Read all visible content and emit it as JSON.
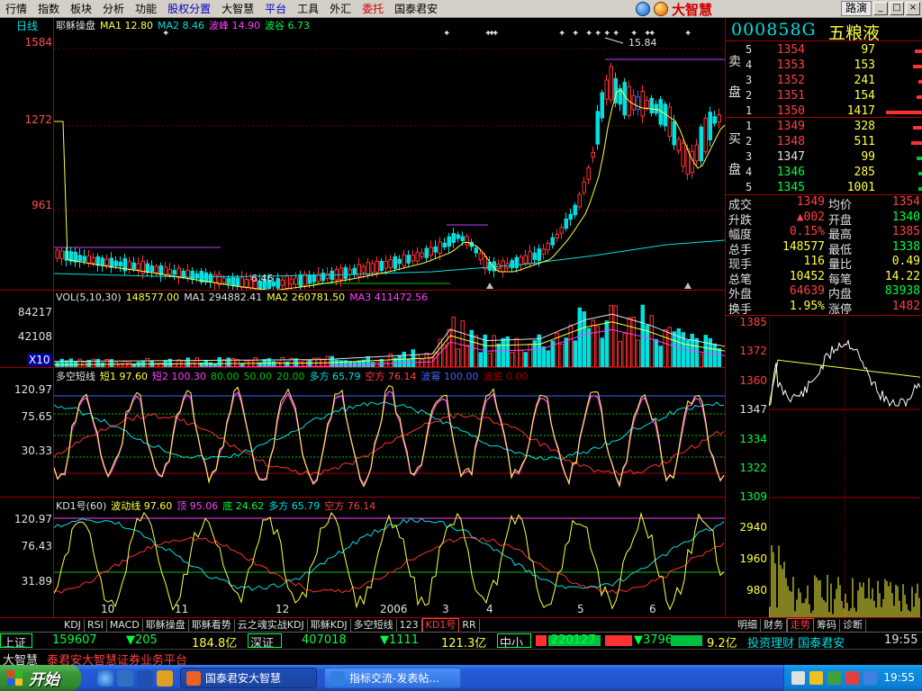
{
  "menu": {
    "items": [
      {
        "label": "行情",
        "color": "normal"
      },
      {
        "label": "指数",
        "color": "normal"
      },
      {
        "label": "板块",
        "color": "normal"
      },
      {
        "label": "分析",
        "color": "normal"
      },
      {
        "label": "功能",
        "color": "normal"
      },
      {
        "label": "股权分置",
        "color": "blue"
      },
      {
        "label": "大智慧",
        "color": "normal"
      },
      {
        "label": "平台",
        "color": "blue"
      },
      {
        "label": "工具",
        "color": "normal"
      },
      {
        "label": "外汇",
        "color": "normal"
      },
      {
        "label": "委托",
        "color": "red"
      },
      {
        "label": "国泰君安",
        "color": "normal"
      }
    ],
    "brand": "大智慧",
    "lumi_button": "路演",
    "win_min": "_",
    "win_max": "□",
    "win_close": "×"
  },
  "main_chart": {
    "period": "日线",
    "header": [
      {
        "text": "耶稣操盘",
        "color": "#e0e0e0"
      },
      {
        "text": "MA1 12.80",
        "color": "#ffff40"
      },
      {
        "text": "MA2 8.46",
        "color": "#00e0e0"
      },
      {
        "text": "波峰 14.90",
        "color": "#ff40ff"
      },
      {
        "text": "波谷 6.73",
        "color": "#00ff40"
      }
    ],
    "y_labels": [
      "1584",
      "1272",
      "961"
    ],
    "annot_high": "15.84",
    "annot_low": "6.46"
  },
  "volume": {
    "header": [
      {
        "text": "VOL(5,10,30)",
        "color": "#e0e0e0"
      },
      {
        "text": "148577.00",
        "color": "#ffff40"
      },
      {
        "text": "MA1 294882.41",
        "color": "#e0e0e0"
      },
      {
        "text": "MA2 260781.50",
        "color": "#ffff40"
      },
      {
        "text": "MA3 411472.56",
        "color": "#ff40ff"
      }
    ],
    "y_labels": [
      "84217",
      "42108"
    ],
    "unit": "X10"
  },
  "ind1": {
    "header": [
      {
        "text": "多空短线",
        "color": "#e0e0e0"
      },
      {
        "text": "短1 97.60",
        "color": "#ffff40"
      },
      {
        "text": "短2 100.30",
        "color": "#ff40ff"
      },
      {
        "text": "80.00",
        "color": "#00c000"
      },
      {
        "text": "50.00",
        "color": "#00c000"
      },
      {
        "text": "20.00",
        "color": "#00c000"
      },
      {
        "text": "多方 65.79",
        "color": "#00e0e0"
      },
      {
        "text": "空方 76.14",
        "color": "#ff4040"
      },
      {
        "text": "波幂 100.00",
        "color": "#4060ff"
      },
      {
        "text": "波底 0.00",
        "color": "#a00000"
      }
    ],
    "y_labels": [
      "120.97",
      "75.65",
      "30.33"
    ]
  },
  "ind2": {
    "header": [
      {
        "text": "KD1号(60)",
        "color": "#e0e0e0"
      },
      {
        "text": "波动线 97.60",
        "color": "#ffff40"
      },
      {
        "text": "顶 95.06",
        "color": "#ff40ff"
      },
      {
        "text": "底 24.62",
        "color": "#00ff40"
      },
      {
        "text": "多方 65.79",
        "color": "#00e0e0"
      },
      {
        "text": "空方 76.14",
        "color": "#ff4040"
      }
    ],
    "y_labels": [
      "120.97",
      "76.43",
      "31.89"
    ],
    "x_labels": [
      "10",
      "11",
      "12",
      "2006",
      "3",
      "4",
      "5",
      "6"
    ]
  },
  "bottom_tabs": [
    "KDJ",
    "RSI",
    "MACD",
    "耶稣操盘",
    "耶稣看势",
    "云之魂实战KDJ",
    "耶稣KDJ",
    "多空短线",
    "123",
    "KD1号",
    "RR"
  ],
  "bottom_tab_active": "KD1号",
  "quote": {
    "code": "000858G",
    "name": "五粮液",
    "sell_label_1": "卖",
    "sell_label_2": "盘",
    "buy_label_1": "买",
    "buy_label_2": "盘",
    "sell": [
      {
        "level": "5",
        "price": "1354",
        "vol": "97"
      },
      {
        "level": "4",
        "price": "1353",
        "vol": "153"
      },
      {
        "level": "3",
        "price": "1352",
        "vol": "241"
      },
      {
        "level": "2",
        "price": "1351",
        "vol": "154"
      },
      {
        "level": "1",
        "price": "1350",
        "vol": "1417"
      }
    ],
    "buy": [
      {
        "level": "1",
        "price": "1349",
        "vol": "328"
      },
      {
        "level": "2",
        "price": "1348",
        "vol": "511"
      },
      {
        "level": "3",
        "price": "1347",
        "vol": "99"
      },
      {
        "level": "4",
        "price": "1346",
        "vol": "285"
      },
      {
        "level": "5",
        "price": "1345",
        "vol": "1001"
      }
    ],
    "stats": [
      {
        "k1": "成交",
        "v1": "1349",
        "c1": "red",
        "k2": "均价",
        "v2": "1354",
        "c2": "red"
      },
      {
        "k1": "升跌",
        "v1": "▲002",
        "c1": "red",
        "k2": "开盘",
        "v2": "1340",
        "c2": "grn"
      },
      {
        "k1": "幅度",
        "v1": "0.15%",
        "c1": "red",
        "k2": "最高",
        "v2": "1385",
        "c2": "red"
      },
      {
        "k1": "总手",
        "v1": "148577",
        "c1": "yel",
        "k2": "最低",
        "v2": "1338",
        "c2": "grn"
      },
      {
        "k1": "现手",
        "v1": "116",
        "c1": "yel",
        "k2": "量比",
        "v2": "0.49",
        "c2": "yel"
      },
      {
        "k1": "总笔",
        "v1": "10452",
        "c1": "yel",
        "k2": "每笔",
        "v2": "14.22",
        "c2": "yel"
      },
      {
        "k1": "外盘",
        "v1": "64639",
        "c1": "red",
        "k2": "内盘",
        "v2": "83938",
        "c2": "grn"
      },
      {
        "k1": "换手",
        "v1": "1.95%",
        "c1": "yel",
        "k2": "涨停",
        "v2": "1482",
        "c2": "red"
      }
    ]
  },
  "mini": {
    "price_labels": [
      "1385",
      "1372",
      "1360",
      "1347",
      "1334",
      "1322",
      "1309"
    ],
    "vol_labels": [
      "2940",
      "1960",
      "980"
    ],
    "tabs": [
      "明细",
      "财务",
      "走势",
      "筹码",
      "诊断"
    ],
    "tab_active": "走势"
  },
  "ticker": {
    "sh_label": "上证",
    "sh_value": "159607",
    "sh_change": "▼205",
    "sh_amount": "184.8亿",
    "sz_label": "深证",
    "sz_value": "407018",
    "sz_change": "▼1111",
    "sz_amount": "121.3亿",
    "sme_label": "中小",
    "sme_value": "220127",
    "sme_change": "▼3796",
    "sme_amount": "9.2亿",
    "promo": "投资理财 国泰君安",
    "time": "19:55"
  },
  "marquee": {
    "label": "大智慧",
    "text": "泰君安大智慧证券业务平台"
  },
  "taskbar": {
    "start": "开始",
    "tasks": [
      {
        "label": "国泰君安大智慧",
        "active": true
      },
      {
        "label": "指标交流-发表帖...",
        "active": false
      }
    ],
    "clock": "19:55"
  }
}
